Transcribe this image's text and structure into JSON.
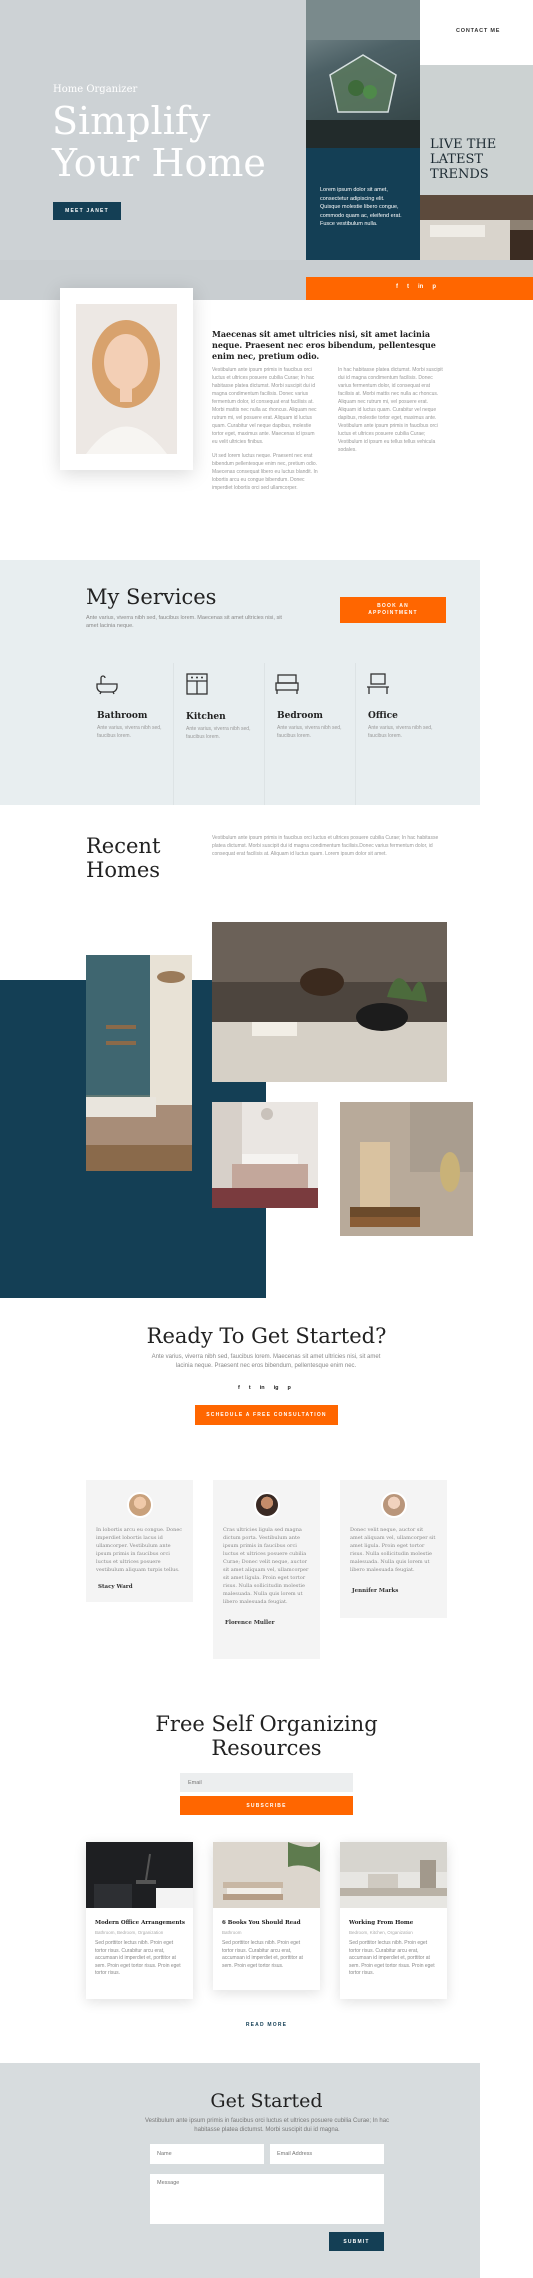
{
  "colors": {
    "accent": "#ff6600",
    "navy": "#143f55",
    "greybg": "#cdd2d5",
    "light": "#e8eef0"
  },
  "nav": {
    "contact": "CONTACT ME"
  },
  "hero": {
    "eyebrow": "Home Organizer",
    "title_line1": "Simplify",
    "title_line2": "Your Home",
    "cta": "MEET JANET",
    "blurb": "Lorem ipsum dolor sit amet, consectetur adipiscing elit. Quisque molestie libero congue, commodo quam ac, eleifend erat. Fusce vestibulum nulla.",
    "trends_line1": "LIVE THE",
    "trends_line2": "LATEST",
    "trends_line3": "TRENDS",
    "social": [
      "f",
      "t",
      "in",
      "p"
    ]
  },
  "about": {
    "lead": "Maecenas sit amet ultricies nisi, sit amet lacinia neque. Praesent nec eros bibendum, pellentesque enim nec, pretium odio.",
    "col1": "Vestibulum ante ipsum primis in faucibus orci luctus et ultrices posuere cubilia Curae; In hac habitasse platea dictumst. Morbi suscipit dui id magna condimentum facilisis. Donec varius fermentum dolor, id consequat erat facilisis at. Morbi mattis nec nulla ac rhoncus. Aliquam nec rutrum mi, vel posuere erat. Aliquam id luctus quam. Curabitur vel neque dapibus, molestie tortor eget, maximus ante. Maecenas id ipsum eu velit ultricies finibus.",
    "col1b": "Ut sed lorem luctus neque. Praesent nec erat bibendum pellentesque enim nec, pretium odio. Maecenas consequat libero eu luctus blandit. In lobortis arcu eu congue bibendum. Donec imperdiet lobortis orci sed ullamcorper.",
    "col2": "In hac habitasse platea dictumst. Morbi suscipit dui id magna condimentum facilisis. Donec varius fermentum dolor, id consequat erat facilisis at. Morbi mattis nec nulla ac rhoncus. Aliquam nec rutrum mi, vel posuere erat. Aliquam id luctus quam. Curabitur vel neque dapibus, molestie tortor eget, maximus ante. Vestibulum ante ipsum primis in faucibus orci luctus et ultrices posuere cubilia Curae; Vestibulum id ipsum eu tellus tellus vehicula sodales."
  },
  "services": {
    "title": "My Services",
    "desc": "Ante varius, viverra nibh sed, faucibus lorem. Maecenas sit amet ultricies nisi, sit amet lacinia neque.",
    "cta": "BOOK AN APPOINTMENT",
    "items": [
      {
        "name": "Bathroom",
        "icon": "bathtub-icon",
        "text": "Ante varius, viverra nibh sed, faucibus lorem."
      },
      {
        "name": "Kitchen",
        "icon": "kitchen-icon",
        "text": "Ante varius, viverra nibh sed, faucibus lorem."
      },
      {
        "name": "Bedroom",
        "icon": "bed-icon",
        "text": "Ante varius, viverra nibh sed, faucibus lorem."
      },
      {
        "name": "Office",
        "icon": "desk-icon",
        "text": "Ante varius, viverra nibh sed, faucibus lorem."
      }
    ]
  },
  "recent": {
    "title_line1": "Recent",
    "title_line2": "Homes",
    "desc": "Vestibulum ante ipsum primis in faucibus orci luctus et ultrices posuere cubilia Curae; In hac habitasse platea dictumst. Morbi suscipit dui id magna condimentum facilisis.Donec varius fermentum dolor, id consequat erat facilisis at. Aliquam id luctus quam. Lorem ipsum dolor sit amet."
  },
  "getstarted": {
    "title": "Ready To Get Started?",
    "desc": "Ante varius, viverra nibh sed, faucibus lorem. Maecenas sit amet ultricies nisi, sit amet lacinia neque. Praesent nec eros bibendum, pellentesque enim nec.",
    "social": [
      "f",
      "t",
      "in",
      "ig",
      "p"
    ],
    "cta": "SCHEDULE A FREE CONSULTATION"
  },
  "testimonials": [
    {
      "text": "In lobortis arcu eu congue. Donec imperdiet lobortis lacus id ullamcorper. Vestibulum ante ipsum primis in faucibus orci luctus et ultrices posuere vestibulum aliquam turpis tellus.",
      "name": "Stacy Ward"
    },
    {
      "text": "Cras ultricies ligula sed magna dictum porta. Vestibulum ante ipsum primis in faucibus orci luctus et ultrices posuere cubilia Curae; Donec velit neque, auctor sit amet aliquam vel, ullamcorper sit amet ligula. Proin eget tortor risus. Nulla sollicitudin molestie malesuada. Nulla quis lorem ut libero malesuada feugiat.",
      "name": "Florence Muller"
    },
    {
      "text": "Donec velit neque, auctor sit amet aliquam vel, ullamcorper sit amet ligula. Proin eget tortor risus. Nulla sollicitudin molestie malesuada. Nulla quis lorem ut libero malesuada feugiat.",
      "name": "Jennifer Marks"
    }
  ],
  "resources": {
    "title_line1": "Free Self Organizing",
    "title_line2": "Resources",
    "email_placeholder": "Email",
    "subscribe": "SUBSCRIBE",
    "posts": [
      {
        "title": "Modern Office Arrangements",
        "meta": "Bathroom, Bedroom, Organization",
        "text": "Sed porttitor lectus nibh. Proin eget tortor risus. Curabitur arcu erat, accumsan id imperdiet et, porttitor at sem. Proin eget tortor risus. Proin eget tortor risus."
      },
      {
        "title": "6 Books You Should Read",
        "meta": "Bathroom",
        "text": "Sed porttitor lectus nibh. Proin eget tortor risus. Curabitur arcu erat, accumsan id imperdiet et, porttitor at sem. Proin eget tortor risus."
      },
      {
        "title": "Working From Home",
        "meta": "Bedroom, Kitchen, Organization",
        "text": "Sed porttitor lectus nibh. Proin eget tortor risus. Curabitur arcu erat, accumsan id imperdiet et, porttitor at sem. Proin eget tortor risus. Proin eget tortor risus."
      }
    ],
    "read_more": "READ MORE"
  },
  "contact": {
    "title": "Get Started",
    "desc": "Vestibulum ante ipsum primis in faucibus orci luctus et ultrices posuere cubilia Curae; In hac habitasse platea dictumst. Morbi suscipit dui id magna.",
    "name_placeholder": "Name",
    "email_placeholder": "Email Address",
    "message_placeholder": "Message",
    "submit": "SUBMIT"
  }
}
